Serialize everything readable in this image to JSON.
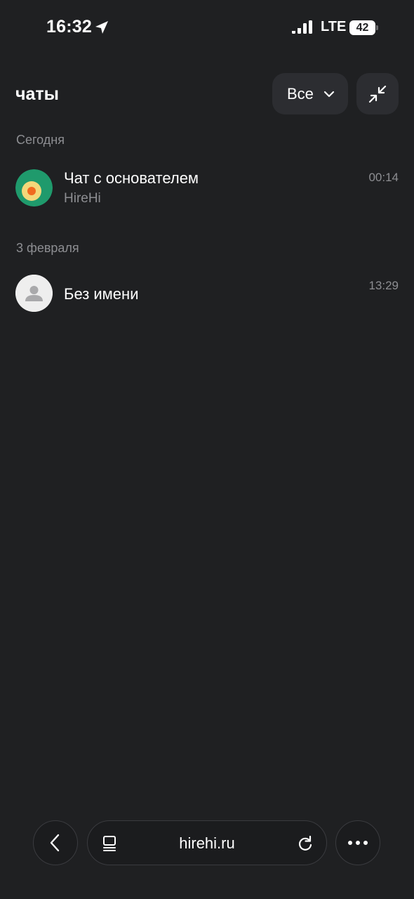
{
  "status_bar": {
    "time": "16:32",
    "network": "LTE",
    "battery": "42",
    "icons": [
      "location-arrow-icon",
      "signal-bars-icon",
      "battery-icon"
    ]
  },
  "header": {
    "title": "чаты",
    "filter_label": "Все",
    "icons": [
      "chevron-down-icon",
      "collapse-arrows-icon"
    ]
  },
  "sections": [
    {
      "label": "Сегодня",
      "chats": [
        {
          "title": "Чат с основателем",
          "subtitle": "HireHi",
          "time": "00:14",
          "avatar": "hirehi-logo"
        }
      ]
    },
    {
      "label": "3 февраля",
      "chats": [
        {
          "title": "Без имени",
          "subtitle": "",
          "time": "13:29",
          "avatar": "person-placeholder-icon"
        }
      ]
    }
  ],
  "browser_bar": {
    "url": "hirehi.ru",
    "icons": [
      "back-arrow-icon",
      "tabs-icon",
      "reload-icon",
      "more-dots-icon"
    ]
  },
  "colors": {
    "background": "#1f2022",
    "button_bg": "#2c2d31",
    "secondary_text": "#8d8e92",
    "logo_green": "#1f9a6c",
    "logo_yellow": "#f3d77a",
    "logo_orange": "#f0691f"
  }
}
